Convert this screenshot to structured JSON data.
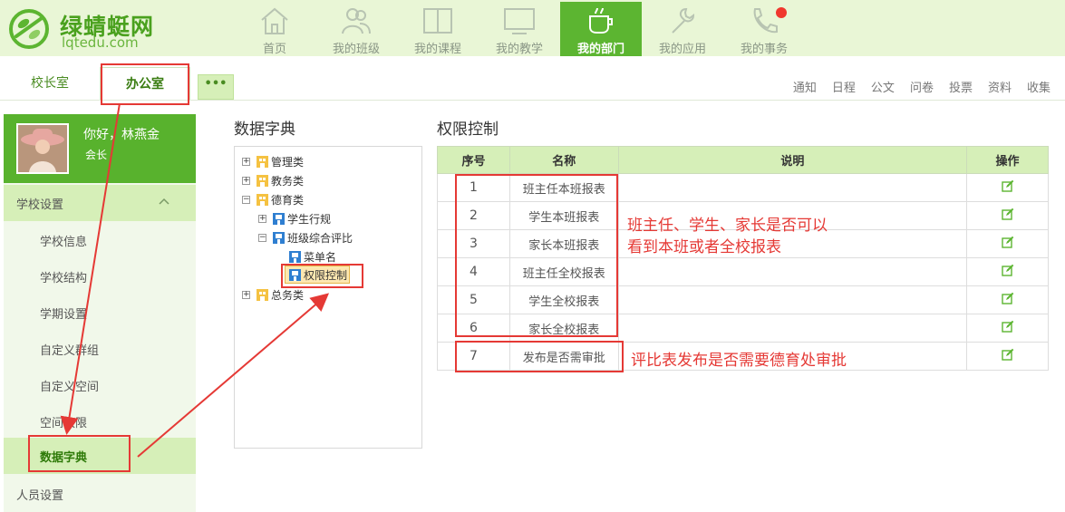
{
  "brand": {
    "name": "绿蜻蜓网",
    "url": "lqtedu.com"
  },
  "nav": [
    {
      "label": "首页",
      "icon": "home-icon"
    },
    {
      "label": "我的班级",
      "icon": "people-icon"
    },
    {
      "label": "我的课程",
      "icon": "book-icon"
    },
    {
      "label": "我的教学",
      "icon": "monitor-icon"
    },
    {
      "label": "我的部门",
      "icon": "coffee-cup-icon",
      "active": true
    },
    {
      "label": "我的应用",
      "icon": "wrench-icon"
    },
    {
      "label": "我的事务",
      "icon": "phone-icon",
      "badge": true
    }
  ],
  "tabs": {
    "principal": "校长室",
    "office": "办公室",
    "more": "•••"
  },
  "quick_links": [
    "通知",
    "日程",
    "公文",
    "问卷",
    "投票",
    "资料",
    "收集"
  ],
  "user": {
    "greeting": "你好，林燕金",
    "role": "会长"
  },
  "sidebar": {
    "group": "学校设置",
    "items": [
      "学校信息",
      "学校结构",
      "学期设置",
      "自定义群组",
      "自定义空间",
      "空间权限"
    ],
    "active": "数据字典",
    "bottom": "人员设置"
  },
  "tree": {
    "title": "数据字典",
    "nodes": {
      "n1": "管理类",
      "n2": "教务类",
      "n3": "德育类",
      "n4": "学生行规",
      "n5": "班级综合评比",
      "n6": "菜单名",
      "n7": "权限控制",
      "n8": "总务类"
    }
  },
  "permission": {
    "title": "权限控制",
    "headers": {
      "num": "序号",
      "name": "名称",
      "desc": "说明",
      "op": "操作"
    },
    "rows": [
      {
        "num": "1",
        "name": "班主任本班报表",
        "desc": ""
      },
      {
        "num": "2",
        "name": "学生本班报表",
        "desc": ""
      },
      {
        "num": "3",
        "name": "家长本班报表",
        "desc": ""
      },
      {
        "num": "4",
        "name": "班主任全校报表",
        "desc": ""
      },
      {
        "num": "5",
        "name": "学生全校报表",
        "desc": ""
      },
      {
        "num": "6",
        "name": "家长全校报表",
        "desc": ""
      },
      {
        "num": "7",
        "name": "发布是否需审批",
        "desc": ""
      }
    ]
  },
  "annotations": {
    "note1_line1": "班主任、学生、家长是否可以",
    "note1_line2": "看到本班或者全校报表",
    "note2": "评比表发布是否需要德育处审批"
  },
  "colors": {
    "brand_green": "#5cb531",
    "light_green": "#d6efb8",
    "annotation_red": "#e53935"
  }
}
